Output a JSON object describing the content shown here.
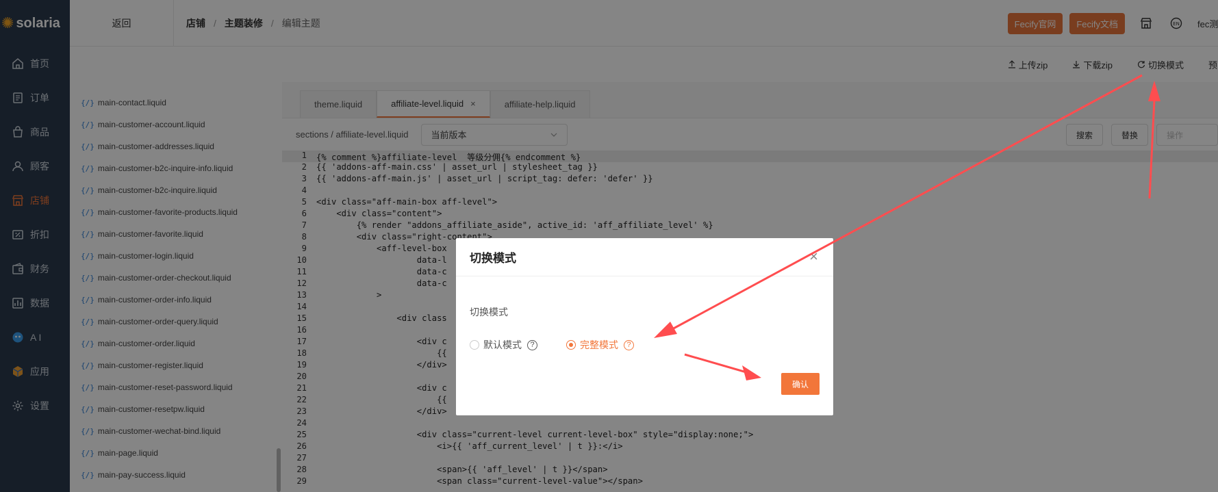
{
  "app": {
    "logo_text": "solaria"
  },
  "sidebar": {
    "items": [
      {
        "label": "首页",
        "icon": "home-icon"
      },
      {
        "label": "订单",
        "icon": "order-icon"
      },
      {
        "label": "商品",
        "icon": "bag-icon"
      },
      {
        "label": "顾客",
        "icon": "user-icon"
      },
      {
        "label": "店铺",
        "icon": "store-icon",
        "active": true
      },
      {
        "label": "折扣",
        "icon": "discount-icon"
      },
      {
        "label": "财务",
        "icon": "wallet-icon"
      },
      {
        "label": "数据",
        "icon": "chart-icon"
      },
      {
        "label": "A I",
        "icon": "ai-icon"
      },
      {
        "label": "应用",
        "icon": "app-icon"
      },
      {
        "label": "设置",
        "icon": "gear-icon"
      }
    ]
  },
  "topbar": {
    "back": "返回",
    "breadcrumb": [
      "店铺",
      "主题装修",
      "编辑主题"
    ],
    "official": "Fecify官网",
    "docs": "Fecify文档",
    "user": "fec测"
  },
  "toolbar": {
    "upload": "上传zip",
    "download": "下载zip",
    "switch_mode": "切换模式",
    "preview": "预"
  },
  "files": [
    "main-contact.liquid",
    "main-customer-account.liquid",
    "main-customer-addresses.liquid",
    "main-customer-b2c-inquire-info.liquid",
    "main-customer-b2c-inquire.liquid",
    "main-customer-favorite-products.liquid",
    "main-customer-favorite.liquid",
    "main-customer-login.liquid",
    "main-customer-order-checkout.liquid",
    "main-customer-order-info.liquid",
    "main-customer-order-query.liquid",
    "main-customer-order.liquid",
    "main-customer-register.liquid",
    "main-customer-reset-password.liquid",
    "main-customer-resetpw.liquid",
    "main-customer-wechat-bind.liquid",
    "main-page.liquid",
    "main-pay-success.liquid"
  ],
  "file_icon": "{/}",
  "editor": {
    "tabs": [
      "theme.liquid",
      "affiliate-level.liquid",
      "affiliate-help.liquid"
    ],
    "tab_close": "×",
    "path": "sections / affiliate-level.liquid",
    "version": "当前版本",
    "search": "搜索",
    "replace": "替换",
    "operate": "操作"
  },
  "code_lines": [
    {
      "n": "1",
      "t": "{% comment %}affiliate-level  等级分佣{% endcomment %}"
    },
    {
      "n": "2",
      "t": "{{ 'addons-aff-main.css' | asset_url | stylesheet_tag }}"
    },
    {
      "n": "3",
      "t": "{{ 'addons-aff-main.js' | asset_url | script_tag: defer: 'defer' }}"
    },
    {
      "n": "4",
      "t": ""
    },
    {
      "n": "5",
      "t": "<div class=\"aff-main-box aff-level\">"
    },
    {
      "n": "6",
      "t": "    <div class=\"content\">"
    },
    {
      "n": "7",
      "t": "        {% render \"addons_affiliate_aside\", active_id: 'aff_affiliate_level' %}"
    },
    {
      "n": "8",
      "t": "        <div class=\"right-content\">"
    },
    {
      "n": "9",
      "t": "            <aff-level-box"
    },
    {
      "n": "10",
      "t": "                    data-l"
    },
    {
      "n": "11",
      "t": "                    data-c"
    },
    {
      "n": "12",
      "t": "                    data-c"
    },
    {
      "n": "13",
      "t": "            >"
    },
    {
      "n": "14",
      "t": ""
    },
    {
      "n": "15",
      "t": "                <div class"
    },
    {
      "n": "16",
      "t": ""
    },
    {
      "n": "17",
      "t": "                    <div c"
    },
    {
      "n": "18",
      "t": "                        {{"
    },
    {
      "n": "19",
      "t": "                    </div>"
    },
    {
      "n": "20",
      "t": ""
    },
    {
      "n": "21",
      "t": "                    <div c"
    },
    {
      "n": "22",
      "t": "                        {{"
    },
    {
      "n": "23",
      "t": "                    </div>"
    },
    {
      "n": "24",
      "t": ""
    },
    {
      "n": "25",
      "t": "                    <div class=\"current-level current-level-box\" style=\"display:none;\">"
    },
    {
      "n": "26",
      "t": "                        <i>{{ 'aff_current_level' | t }}:</i>"
    },
    {
      "n": "27",
      "t": ""
    },
    {
      "n": "28",
      "t": "                        <span>{{ 'aff_level' | t }}</span>"
    },
    {
      "n": "29",
      "t": "                        <span class=\"current-level-value\"></span>"
    }
  ],
  "modal": {
    "title": "切换模式",
    "close": "×",
    "label": "切换模式",
    "options": [
      {
        "label": "默认模式",
        "selected": false
      },
      {
        "label": "完整模式",
        "selected": true
      }
    ],
    "help": "?",
    "confirm": "确认"
  },
  "colors": {
    "accent": "#f2763a",
    "sidebar": "#2b3a4d",
    "arrow": "#ff4d4f"
  }
}
